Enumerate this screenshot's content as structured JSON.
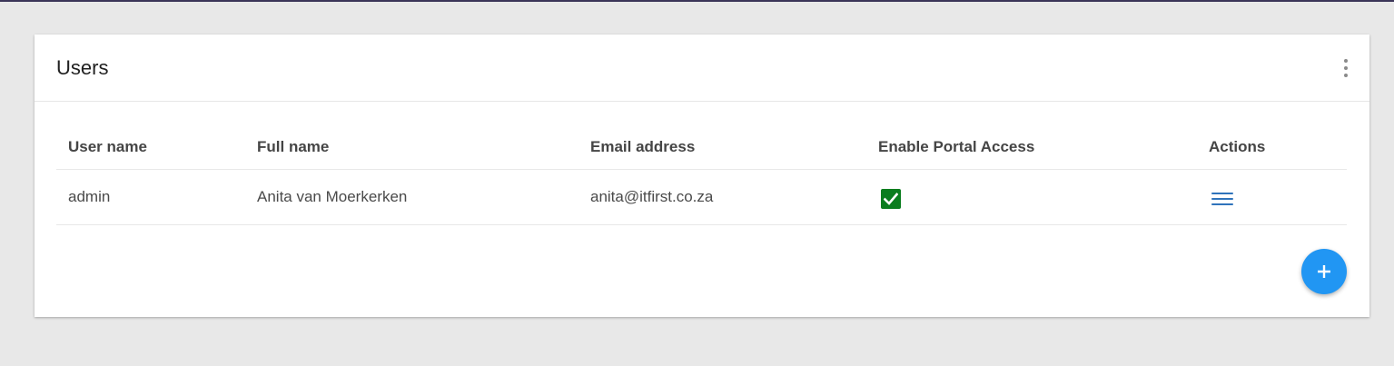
{
  "card": {
    "title": "Users",
    "menu_icon": "more-vert-icon"
  },
  "table": {
    "columns": [
      "User name",
      "Full name",
      "Email address",
      "Enable Portal Access",
      "Actions"
    ],
    "rows": [
      {
        "user_name": "admin",
        "full_name": "Anita van Moerkerken",
        "email": "anita@itfirst.co.za",
        "portal_access": true,
        "actions_icon": "hamburger-menu-icon"
      }
    ]
  },
  "fab": {
    "icon": "plus-icon"
  },
  "colors": {
    "checkbox_checked": "#0a7d1e",
    "actions_icon": "#2f73bb",
    "fab": "#2196f3",
    "background": "#e8e8e8"
  }
}
